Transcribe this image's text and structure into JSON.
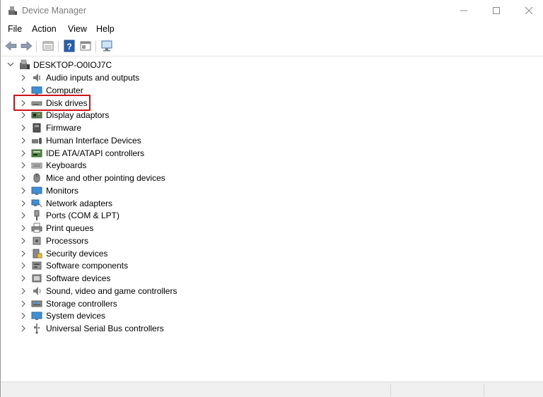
{
  "window": {
    "title": "Device Manager"
  },
  "menubar": {
    "items": [
      "File",
      "Action",
      "View",
      "Help"
    ]
  },
  "toolbar": {
    "buttons": [
      "back-icon",
      "forward-icon",
      "properties-icon",
      "help-icon",
      "show-hide-icon",
      "scan-hardware-icon"
    ]
  },
  "tree": {
    "root": "DESKTOP-O0IOJ7C",
    "categories": [
      {
        "label": "Audio inputs and outputs",
        "icon": "speaker-icon"
      },
      {
        "label": "Computer",
        "icon": "computer-icon"
      },
      {
        "label": "Disk drives",
        "icon": "disk-drive-icon",
        "highlighted": true
      },
      {
        "label": "Display adaptors",
        "icon": "display-adapter-icon"
      },
      {
        "label": "Firmware",
        "icon": "firmware-icon"
      },
      {
        "label": "Human Interface Devices",
        "icon": "hid-icon"
      },
      {
        "label": "IDE ATA/ATAPI controllers",
        "icon": "ide-controller-icon"
      },
      {
        "label": "Keyboards",
        "icon": "keyboard-icon"
      },
      {
        "label": "Mice and other pointing devices",
        "icon": "mouse-icon"
      },
      {
        "label": "Monitors",
        "icon": "monitor-icon"
      },
      {
        "label": "Network adapters",
        "icon": "network-adapter-icon"
      },
      {
        "label": "Ports (COM & LPT)",
        "icon": "port-icon"
      },
      {
        "label": "Print queues",
        "icon": "printer-icon"
      },
      {
        "label": "Processors",
        "icon": "processor-icon"
      },
      {
        "label": "Security devices",
        "icon": "security-device-icon"
      },
      {
        "label": "Software components",
        "icon": "software-component-icon"
      },
      {
        "label": "Software devices",
        "icon": "software-device-icon"
      },
      {
        "label": "Sound, video and game controllers",
        "icon": "sound-controller-icon"
      },
      {
        "label": "Storage controllers",
        "icon": "storage-controller-icon"
      },
      {
        "label": "System devices",
        "icon": "system-device-icon"
      },
      {
        "label": "Universal Serial Bus controllers",
        "icon": "usb-icon"
      }
    ]
  },
  "colors": {
    "highlight": "#d0141a",
    "accent": "#1e6fc9"
  }
}
